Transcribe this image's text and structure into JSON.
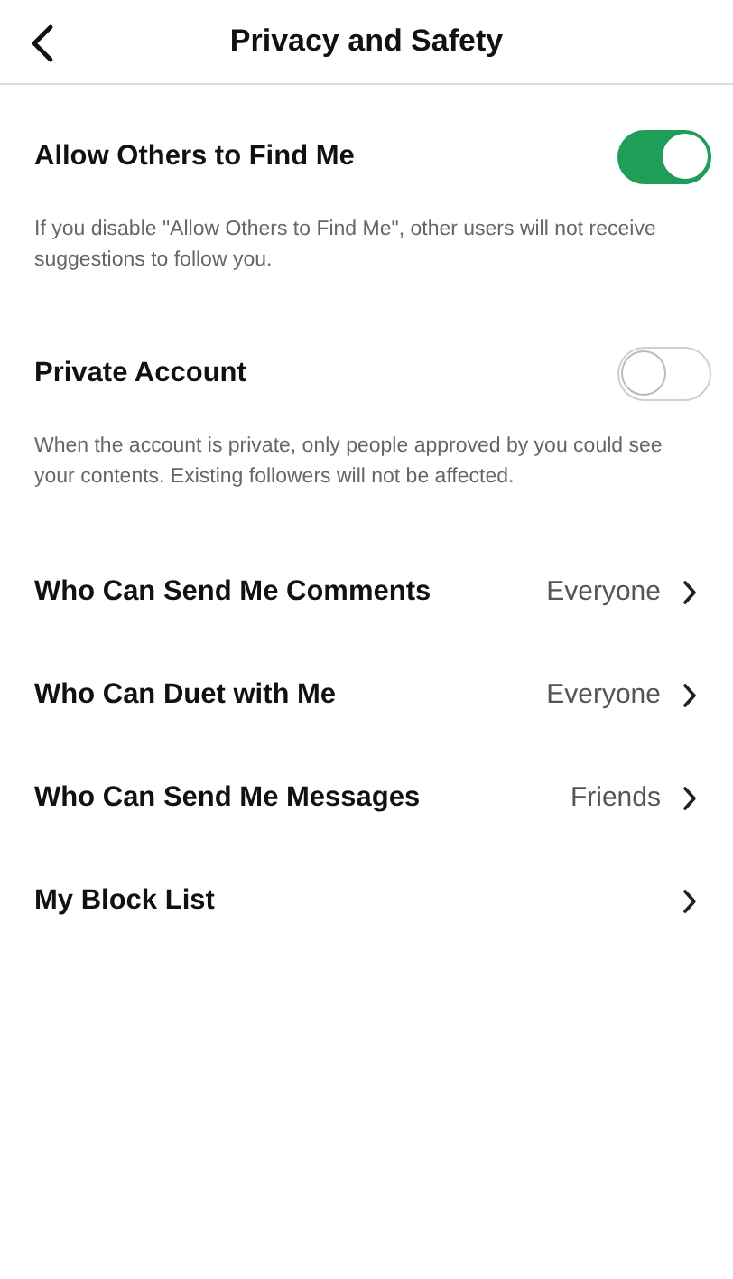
{
  "header": {
    "title": "Privacy and Safety"
  },
  "settings": [
    {
      "kind": "toggle",
      "label": "Allow Others to Find Me",
      "on": true
    },
    {
      "kind": "note",
      "text": "If you disable \"Allow Others to Find Me\", other users will not receive suggestions to follow you."
    },
    {
      "kind": "toggle",
      "label": "Private Account",
      "on": false
    },
    {
      "kind": "note",
      "text": "When the account is private, only people approved by you could see your contents. Existing followers will not be affected."
    },
    {
      "kind": "link",
      "label": "Who Can Send Me Comments",
      "value": "Everyone"
    },
    {
      "kind": "link",
      "label": "Who Can Duet with Me",
      "value": "Everyone"
    },
    {
      "kind": "link",
      "label": "Who Can Send Me Messages",
      "value": "Friends"
    },
    {
      "kind": "link",
      "label": "My Block List"
    }
  ]
}
